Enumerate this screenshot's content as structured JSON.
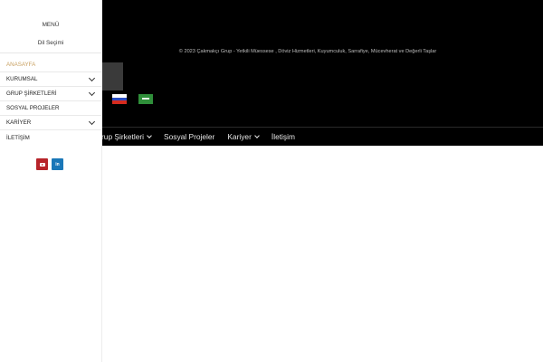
{
  "footer": {
    "copyright": "© 2023 Çakmakçı Grup - Yetkili Müessese , Döviz Hizmetleri, Kuyumculuk, Sarrafiye, Mücevherat ve Değerli Taşlar"
  },
  "languages": [
    {
      "name": "flag-russia-icon"
    },
    {
      "name": "flag-saudi-arabia-icon"
    }
  ],
  "main_nav": [
    {
      "label": "rup Şirketleri",
      "has_dropdown": true
    },
    {
      "label": "Sosyal Projeler",
      "has_dropdown": false
    },
    {
      "label": "Kariyer",
      "has_dropdown": true
    },
    {
      "label": "İletişim",
      "has_dropdown": false
    }
  ],
  "drawer": {
    "title": "MENÜ",
    "language_label": "Dil Seçimi",
    "items": [
      {
        "label": "ANASAYFA",
        "active": true,
        "has_dropdown": false
      },
      {
        "label": "KURUMSAL",
        "active": false,
        "has_dropdown": true
      },
      {
        "label": "GRUP ŞİRKETLERİ",
        "active": false,
        "has_dropdown": true
      },
      {
        "label": "SOSYAL PROJELER",
        "active": false,
        "has_dropdown": false
      },
      {
        "label": "KARİYER",
        "active": false,
        "has_dropdown": true
      },
      {
        "label": "İLETİŞİM",
        "active": false,
        "has_dropdown": false
      }
    ],
    "social": {
      "youtube_icon": "youtube-icon",
      "linkedin_icon": "linkedin-icon",
      "linkedin_text": "in"
    }
  },
  "colors": {
    "active": "#c8a060",
    "background": "#000000",
    "youtube": "#b7242a",
    "linkedin": "#1a77b8"
  }
}
